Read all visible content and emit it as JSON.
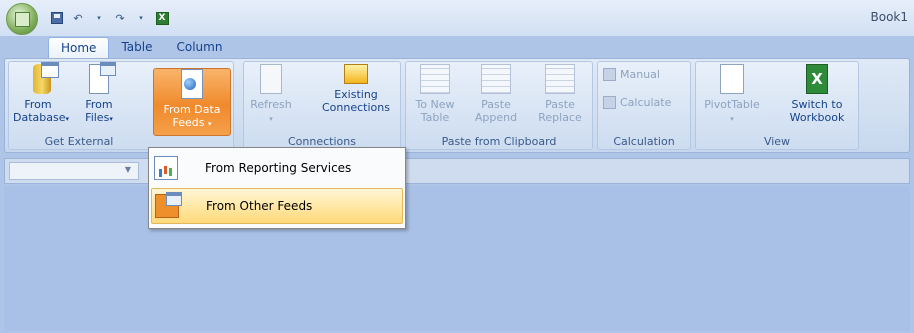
{
  "window": {
    "title": "Book1"
  },
  "quick_access": {
    "save": "save-icon",
    "undo": "undo-icon",
    "redo": "redo-icon",
    "excel": "X"
  },
  "tabs": [
    {
      "label": "Home"
    },
    {
      "label": "Table"
    },
    {
      "label": "Column"
    }
  ],
  "ribbon": {
    "get_external": {
      "label": "Get External",
      "from_database": {
        "line1": "From",
        "line2": "Database"
      },
      "from_files": {
        "line1": "From",
        "line2": "Files"
      },
      "from_data_feeds": {
        "line1": "From Data",
        "line2": "Feeds"
      }
    },
    "connections": {
      "label": "Connections",
      "refresh": "Refresh",
      "existing": {
        "line1": "Existing",
        "line2": "Connections"
      }
    },
    "paste_from_clipboard": {
      "label": "Paste from Clipboard",
      "to_new_table": {
        "line1": "To New",
        "line2": "Table"
      },
      "paste_append": {
        "line1": "Paste",
        "line2": "Append"
      },
      "paste_replace": {
        "line1": "Paste",
        "line2": "Replace"
      }
    },
    "calculation": {
      "label": "Calculation",
      "manual": "Manual",
      "calculate": "Calculate"
    },
    "view": {
      "label": "View",
      "pivottable": "PivotTable",
      "switch_to_workbook": {
        "line1": "Switch to",
        "line2": "Workbook"
      }
    }
  },
  "dropdown_menu": {
    "items": [
      {
        "label": "From Reporting Services"
      },
      {
        "label": "From Other Feeds"
      }
    ]
  },
  "colors": {
    "accent": "#f08a2c",
    "highlight": "#ffe8a6",
    "background": "#aec5e8"
  }
}
